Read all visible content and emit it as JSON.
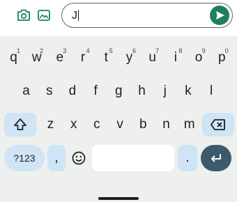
{
  "compose": {
    "camera_icon": "camera-icon",
    "gallery_icon": "gallery-icon",
    "message_value": "J",
    "send_icon": "send-icon",
    "send_color": "#1e7f5e"
  },
  "keyboard": {
    "row1": [
      {
        "label": "q",
        "hint": "1"
      },
      {
        "label": "w",
        "hint": "2"
      },
      {
        "label": "e",
        "hint": "3"
      },
      {
        "label": "r",
        "hint": "4"
      },
      {
        "label": "t",
        "hint": "5"
      },
      {
        "label": "y",
        "hint": "6"
      },
      {
        "label": "u",
        "hint": "7"
      },
      {
        "label": "i",
        "hint": "8"
      },
      {
        "label": "o",
        "hint": "9"
      },
      {
        "label": "p",
        "hint": "0"
      }
    ],
    "row2": [
      "a",
      "s",
      "d",
      "f",
      "g",
      "h",
      "j",
      "k",
      "l"
    ],
    "row3": [
      "z",
      "x",
      "c",
      "v",
      "b",
      "n",
      "m"
    ],
    "shift_icon": "shift-icon",
    "backspace_icon": "backspace-icon",
    "symbols_label": "?123",
    "comma_label": ",",
    "emoji_icon": "emoji-icon",
    "period_label": ".",
    "enter_icon": "enter-icon",
    "special_key_color": "#cfe4f5",
    "background_color": "#edf0ed"
  }
}
